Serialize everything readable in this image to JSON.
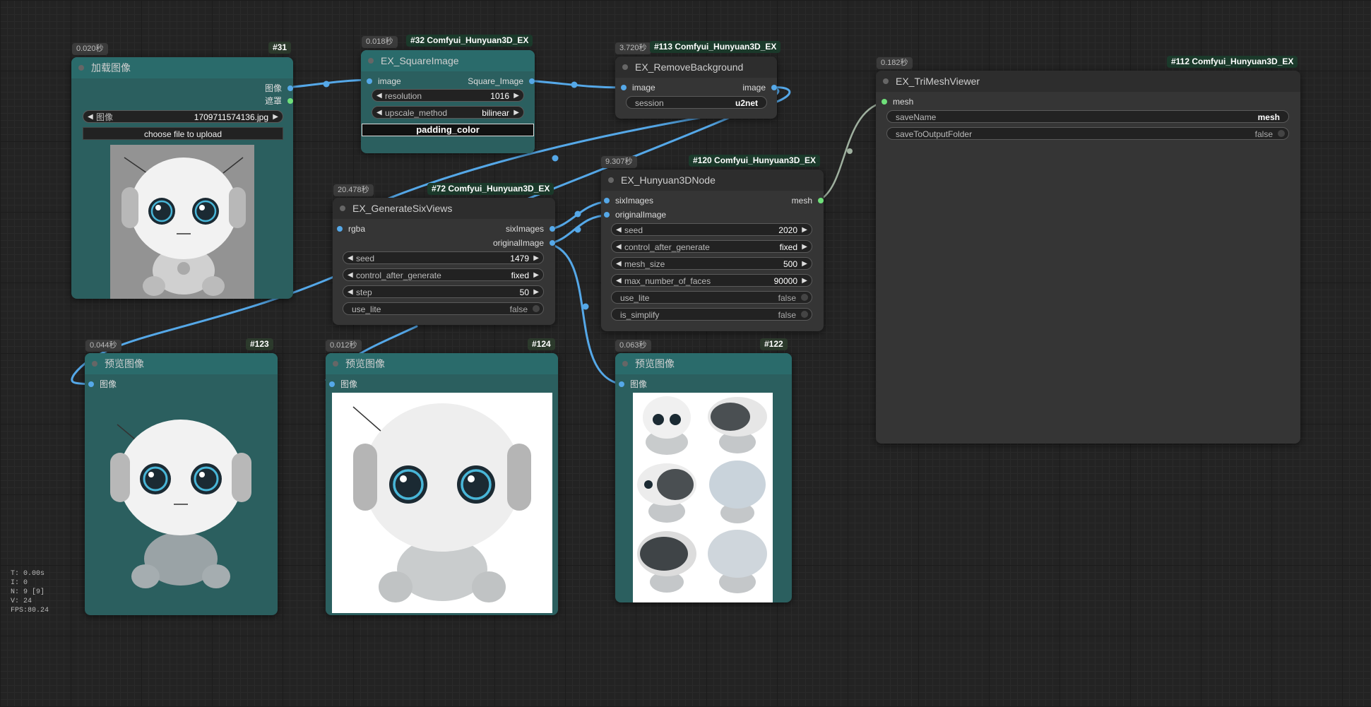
{
  "canvas": {
    "background": "#232323",
    "link_color": "#55a8e8"
  },
  "nodes": {
    "n31": {
      "time": "0.020秒",
      "id": "#31",
      "title": "加载图像",
      "outputs": [
        "图像",
        "遮罩"
      ],
      "image_widget": {
        "label": "图像",
        "value": "1709711574136.jpg"
      },
      "upload_label": "choose file to upload"
    },
    "n32": {
      "time": "0.018秒",
      "id": "#32 Comfyui_Hunyuan3D_EX",
      "title": "EX_SquareImage",
      "input": "image",
      "output": "Square_Image",
      "widgets": [
        {
          "label": "resolution",
          "value": "1016"
        },
        {
          "label": "upscale_method",
          "value": "bilinear"
        }
      ],
      "color_button": "padding_color"
    },
    "n113": {
      "time": "3.720秒",
      "id": "#113 Comfyui_Hunyuan3D_EX",
      "title": "EX_RemoveBackground",
      "input": "image",
      "output": "image",
      "widgets": [
        {
          "label": "session",
          "value": "u2net"
        }
      ]
    },
    "n112": {
      "time": "0.182秒",
      "id": "#112 Comfyui_Hunyuan3D_EX",
      "title": "EX_TriMeshViewer",
      "input": "mesh",
      "widgets": [
        {
          "label": "saveName",
          "value": "mesh"
        },
        {
          "label": "saveToOutputFolder",
          "value": "false"
        }
      ]
    },
    "n120": {
      "time": "9.307秒",
      "id": "#120 Comfyui_Hunyuan3D_EX",
      "title": "EX_Hunyuan3DNode",
      "inputs": [
        "sixImages",
        "originalImage"
      ],
      "output": "mesh",
      "widgets": [
        {
          "label": "seed",
          "value": "2020"
        },
        {
          "label": "control_after_generate",
          "value": "fixed"
        },
        {
          "label": "mesh_size",
          "value": "500"
        },
        {
          "label": "max_number_of_faces",
          "value": "90000"
        }
      ],
      "toggles": [
        {
          "label": "use_lite",
          "value": "false"
        },
        {
          "label": "is_simplify",
          "value": "false"
        }
      ]
    },
    "n72": {
      "time": "20.478秒",
      "id": "#72 Comfyui_Hunyuan3D_EX",
      "title": "EX_GenerateSixViews",
      "input": "rgba",
      "outputs": [
        "sixImages",
        "originalImage"
      ],
      "widgets": [
        {
          "label": "seed",
          "value": "1479"
        },
        {
          "label": "control_after_generate",
          "value": "fixed"
        },
        {
          "label": "step",
          "value": "50"
        }
      ],
      "toggles": [
        {
          "label": "use_lite",
          "value": "false"
        }
      ]
    },
    "n123": {
      "time": "0.044秒",
      "id": "#123",
      "title": "预览图像",
      "input": "图像"
    },
    "n124": {
      "time": "0.012秒",
      "id": "#124",
      "title": "预览图像",
      "input": "图像"
    },
    "n122": {
      "time": "0.063秒",
      "id": "#122",
      "title": "预览图像",
      "input": "图像"
    }
  },
  "stats": {
    "t": "T: 0.00s",
    "i": "I: 0",
    "n": "N: 9 [9]",
    "v": "V: 24",
    "fps": "FPS:80.24"
  }
}
